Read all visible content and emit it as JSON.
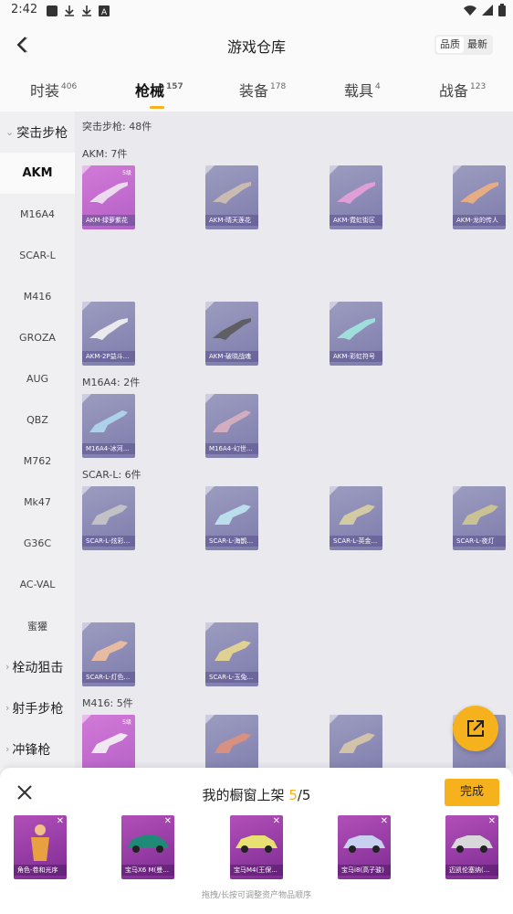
{
  "status": {
    "time": "2:42"
  },
  "header": {
    "title": "游戏仓库",
    "sort_quality": "品质",
    "sort_latest": "最新"
  },
  "tabs": [
    {
      "label": "时装",
      "count": "406"
    },
    {
      "label": "枪械",
      "count": "157"
    },
    {
      "label": "装备",
      "count": "178"
    },
    {
      "label": "载具",
      "count": "4"
    },
    {
      "label": "战备",
      "count": "123"
    }
  ],
  "sidebar": {
    "group_assault": "突击步枪",
    "items": [
      "AKM",
      "M16A4",
      "SCAR-L",
      "M416",
      "GROZA",
      "AUG",
      "QBZ",
      "M762",
      "Mk47",
      "G36C",
      "AC-VAL",
      "蜜獾"
    ],
    "group_bolt": "栓动狙击",
    "group_marksman": "射手步枪",
    "group_smg": "冲锋枪"
  },
  "content": {
    "head": "突击步枪: 48件",
    "akm_title": "AKM: 7件",
    "m16_title": "M16A4: 2件",
    "scar_title": "SCAR-L: 6件",
    "m416_title": "M416: 5件",
    "grade": "5级",
    "akm": [
      "AKM-绿萝紫花",
      "AKM-晴天莲花",
      "AKM-霓虹街区",
      "AKM-龙的传人",
      "AKM-2P益斗...",
      "AKM-破晓战魂",
      "AKM-彩虹符号"
    ],
    "m16": [
      "M16A4-冰河...",
      "M16A4-幻世..."
    ],
    "scar": [
      "SCAR-L-炫彩...",
      "SCAR-L-海鹊...",
      "SCAR-L-英金...",
      "SCAR-L-夜灯",
      "SCAR-L-灯色...",
      "SCAR-L-玉兔..."
    ]
  },
  "sheet": {
    "title": "我的橱窗上架",
    "count": "5",
    "total": "/5",
    "done": "完成",
    "items": [
      "角色-卷和光序",
      "宝马X6 M(曼...",
      "宝马M4(王保...",
      "宝马i8(高子骏)",
      "迈凯伦塞纳(..."
    ],
    "hint": "拖拽/长按可调整资产物品顺序"
  },
  "colors": {
    "accent": "#f5b21c",
    "card_blue": "#8a88b6",
    "card_purple": "#c86bd0"
  }
}
